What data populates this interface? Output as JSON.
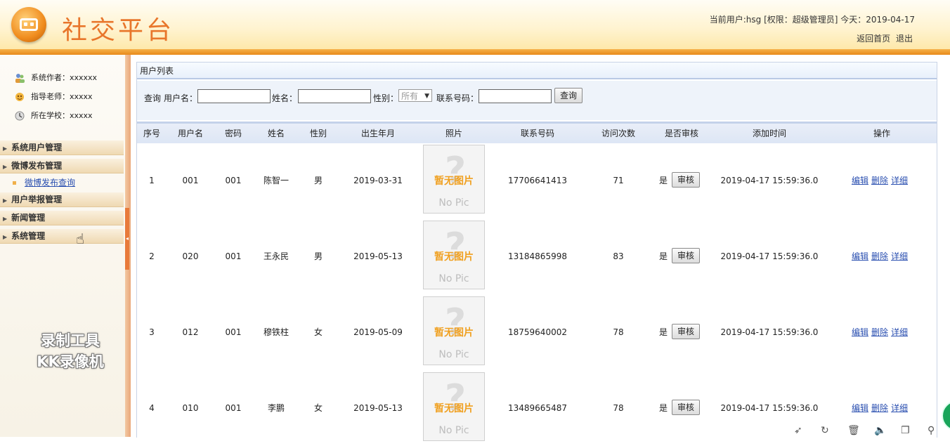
{
  "header": {
    "title": "社交平台",
    "user_info": "当前用户:hsg [权限：超级管理员] 今天：2019-04-17",
    "links": [
      "返回首页",
      "退出"
    ]
  },
  "sidebar": {
    "info": [
      {
        "label": "系统作者：xxxxxx",
        "icon": "users-icon"
      },
      {
        "label": "指导老师：xxxxx",
        "icon": "teacher-icon"
      },
      {
        "label": "所在学校：xxxxx",
        "icon": "school-icon"
      }
    ],
    "menu": [
      {
        "label": "系统用户管理"
      },
      {
        "label": "微博发布管理"
      },
      {
        "label": "用户举报管理"
      },
      {
        "label": "新闻管理"
      },
      {
        "label": "系统管理"
      }
    ],
    "submenu": "微博发布查询"
  },
  "watermark": [
    "录制工具",
    "KK录像机"
  ],
  "panel": {
    "title": "用户列表",
    "search": {
      "query_label": "查询",
      "username_label": "用户名：",
      "name_label": "姓名：",
      "gender_label": "性别：",
      "gender_value": "所有",
      "phone_label": "联系号码：",
      "search_button": "查询"
    },
    "columns": [
      "序号",
      "用户名",
      "密码",
      "姓名",
      "性别",
      "出生年月",
      "照片",
      "联系号码",
      "访问次数",
      "是否审核",
      "添加时间",
      "操作"
    ],
    "photo_text": [
      "暂无图片",
      "No Pic"
    ],
    "rows": [
      {
        "idx": "1",
        "username": "001",
        "password": "001",
        "name": "陈智一",
        "gender": "男",
        "birth": "2019-03-31",
        "phone": "17706641413",
        "visits": "71",
        "audited": "是",
        "audit_btn": "审核",
        "added": "2019-04-17 15:59:36.0",
        "ops": [
          "编辑",
          "删除",
          "详细"
        ]
      },
      {
        "idx": "2",
        "username": "020",
        "password": "001",
        "name": "王永民",
        "gender": "男",
        "birth": "2019-05-13",
        "phone": "13184865998",
        "visits": "83",
        "audited": "是",
        "audit_btn": "审核",
        "added": "2019-04-17 15:59:36.0",
        "ops": [
          "编辑",
          "删除",
          "详细"
        ]
      },
      {
        "idx": "3",
        "username": "012",
        "password": "001",
        "name": "穆铁柱",
        "gender": "女",
        "birth": "2019-05-09",
        "phone": "18759640002",
        "visits": "78",
        "audited": "是",
        "audit_btn": "审核",
        "added": "2019-04-17 15:59:36.0",
        "ops": [
          "编辑",
          "删除",
          "详细"
        ]
      },
      {
        "idx": "4",
        "username": "010",
        "password": "001",
        "name": "李鹏",
        "gender": "女",
        "birth": "2019-05-13",
        "phone": "13489665487",
        "visits": "78",
        "audited": "是",
        "audit_btn": "审核",
        "added": "2019-04-17 15:59:36.0",
        "ops": [
          "编辑",
          "删除",
          "详细"
        ]
      }
    ]
  },
  "colors": {
    "accent": "#e8762b",
    "link": "#2a4fb0",
    "photo_text": "#f0a020"
  }
}
